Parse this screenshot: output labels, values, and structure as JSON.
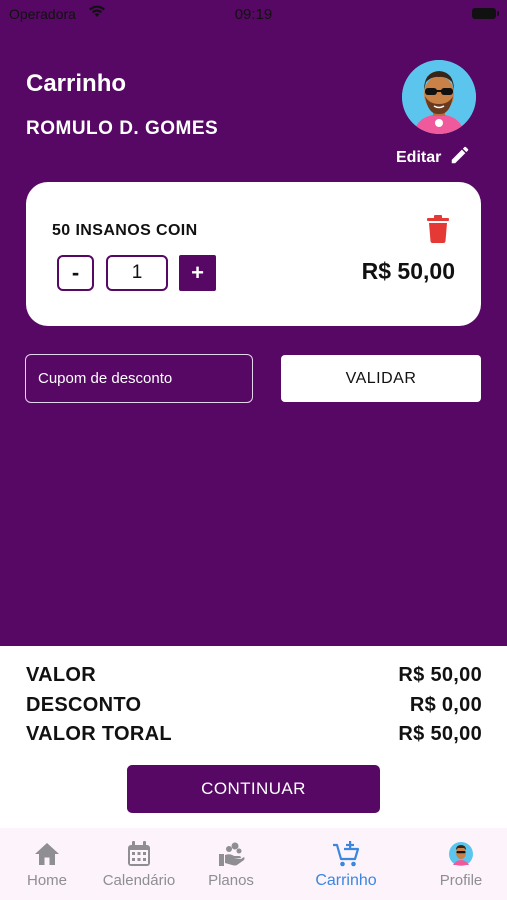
{
  "status_bar": {
    "carrier": "Operadora",
    "time": "09:19"
  },
  "header": {
    "title": "Carrinho",
    "user_name": "ROMULO D. GOMES",
    "edit_label": "Editar"
  },
  "cart": {
    "items": [
      {
        "name": "50 INSANOS COIN",
        "quantity": "1",
        "price": "R$ 50,00",
        "minus_label": "-",
        "plus_label": "+"
      }
    ]
  },
  "coupon": {
    "placeholder": "Cupom de desconto",
    "value": "",
    "validate_label": "VALIDAR"
  },
  "summary": {
    "rows": [
      {
        "label": "VALOR",
        "value": "R$ 50,00"
      },
      {
        "label": "DESCONTO",
        "value": "R$ 0,00"
      },
      {
        "label": "VALOR TORAL",
        "value": "R$ 50,00"
      }
    ]
  },
  "continue_label": "CONTINUAR",
  "tabs": [
    {
      "label": "Home",
      "icon": "home-icon",
      "active": false
    },
    {
      "label": "Calendário",
      "icon": "calendar-icon",
      "active": false
    },
    {
      "label": "Planos",
      "icon": "plans-icon",
      "active": false
    },
    {
      "label": "Carrinho",
      "icon": "cart-icon",
      "active": true
    },
    {
      "label": "Profile",
      "icon": "avatar-icon",
      "active": false
    }
  ],
  "colors": {
    "primary": "#560864",
    "delete": "#e53935",
    "active_tab": "#3b87e0",
    "inactive_tab": "#8e8e93",
    "tab_bar_bg": "#fcf3fb"
  }
}
